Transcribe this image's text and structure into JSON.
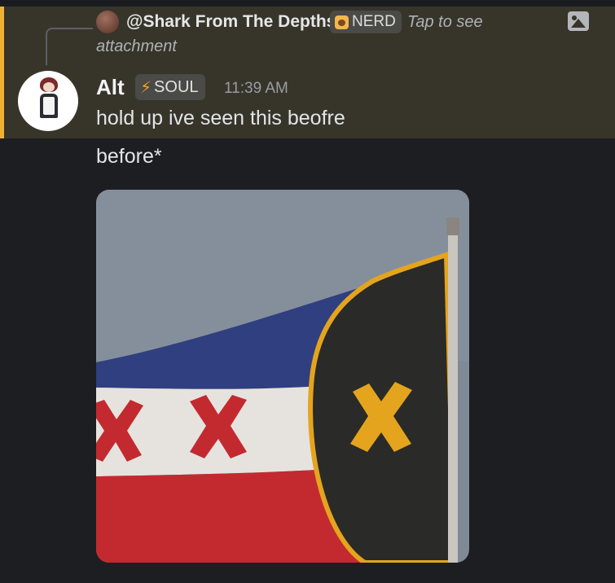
{
  "reply": {
    "author": "@Shark From The Depths",
    "tag_label": "NERD",
    "tag_icon": "nerd-face-icon",
    "preview_text_1": "Tap to see",
    "preview_text_2": "attachment",
    "attachment_icon": "image-icon"
  },
  "message": {
    "author": "Alt",
    "tag_label": "SOUL",
    "tag_icon": "lightning-bolt-icon",
    "timestamp": "11:39 AM",
    "lines": [
      "hold up ive seen this beofre",
      "before*"
    ],
    "attachment": {
      "kind": "image",
      "subject": "flag-waving-photo"
    }
  },
  "colors": {
    "background": "#1d1e22",
    "mention_highlight": "#37352a",
    "mention_bar": "#f0b232",
    "flag_blue": "#2f3f7f",
    "flag_white": "#e6e3df",
    "flag_red": "#c32a2f",
    "flag_black": "#2a2a28",
    "flag_gold": "#e4a41d"
  }
}
